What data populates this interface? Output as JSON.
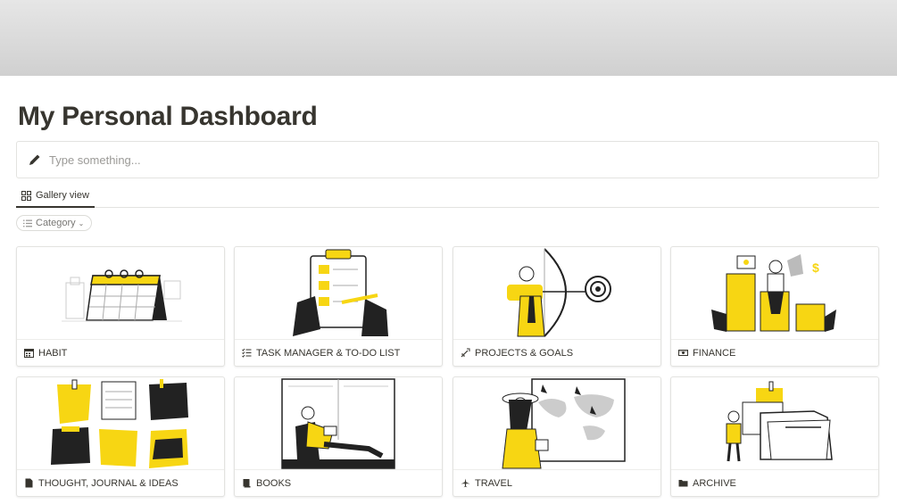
{
  "page": {
    "title": "My Personal Dashboard",
    "colors": {
      "accent": "#f7d613",
      "text": "#37352f",
      "muted": "#9b9a97"
    }
  },
  "callout": {
    "icon": "pencil-icon",
    "placeholder": "Type something..."
  },
  "views": {
    "active": {
      "icon": "grid-icon",
      "label": "Gallery view"
    }
  },
  "filter": {
    "icon": "list-icon",
    "label": "Category"
  },
  "cards": [
    {
      "label": "HABIT",
      "icon": "calendar-icon"
    },
    {
      "label": "TASK MANAGER & TO-DO LIST",
      "icon": "checklist-icon"
    },
    {
      "label": "PROJECTS & GOALS",
      "icon": "dart-icon"
    },
    {
      "label": "FINANCE",
      "icon": "money-icon"
    },
    {
      "label": "THOUGHT, JOURNAL & IDEAS",
      "icon": "document-icon"
    },
    {
      "label": "BOOKS",
      "icon": "book-icon"
    },
    {
      "label": "TRAVEL",
      "icon": "airplane-icon"
    },
    {
      "label": "ARCHIVE",
      "icon": "folder-icon"
    }
  ]
}
